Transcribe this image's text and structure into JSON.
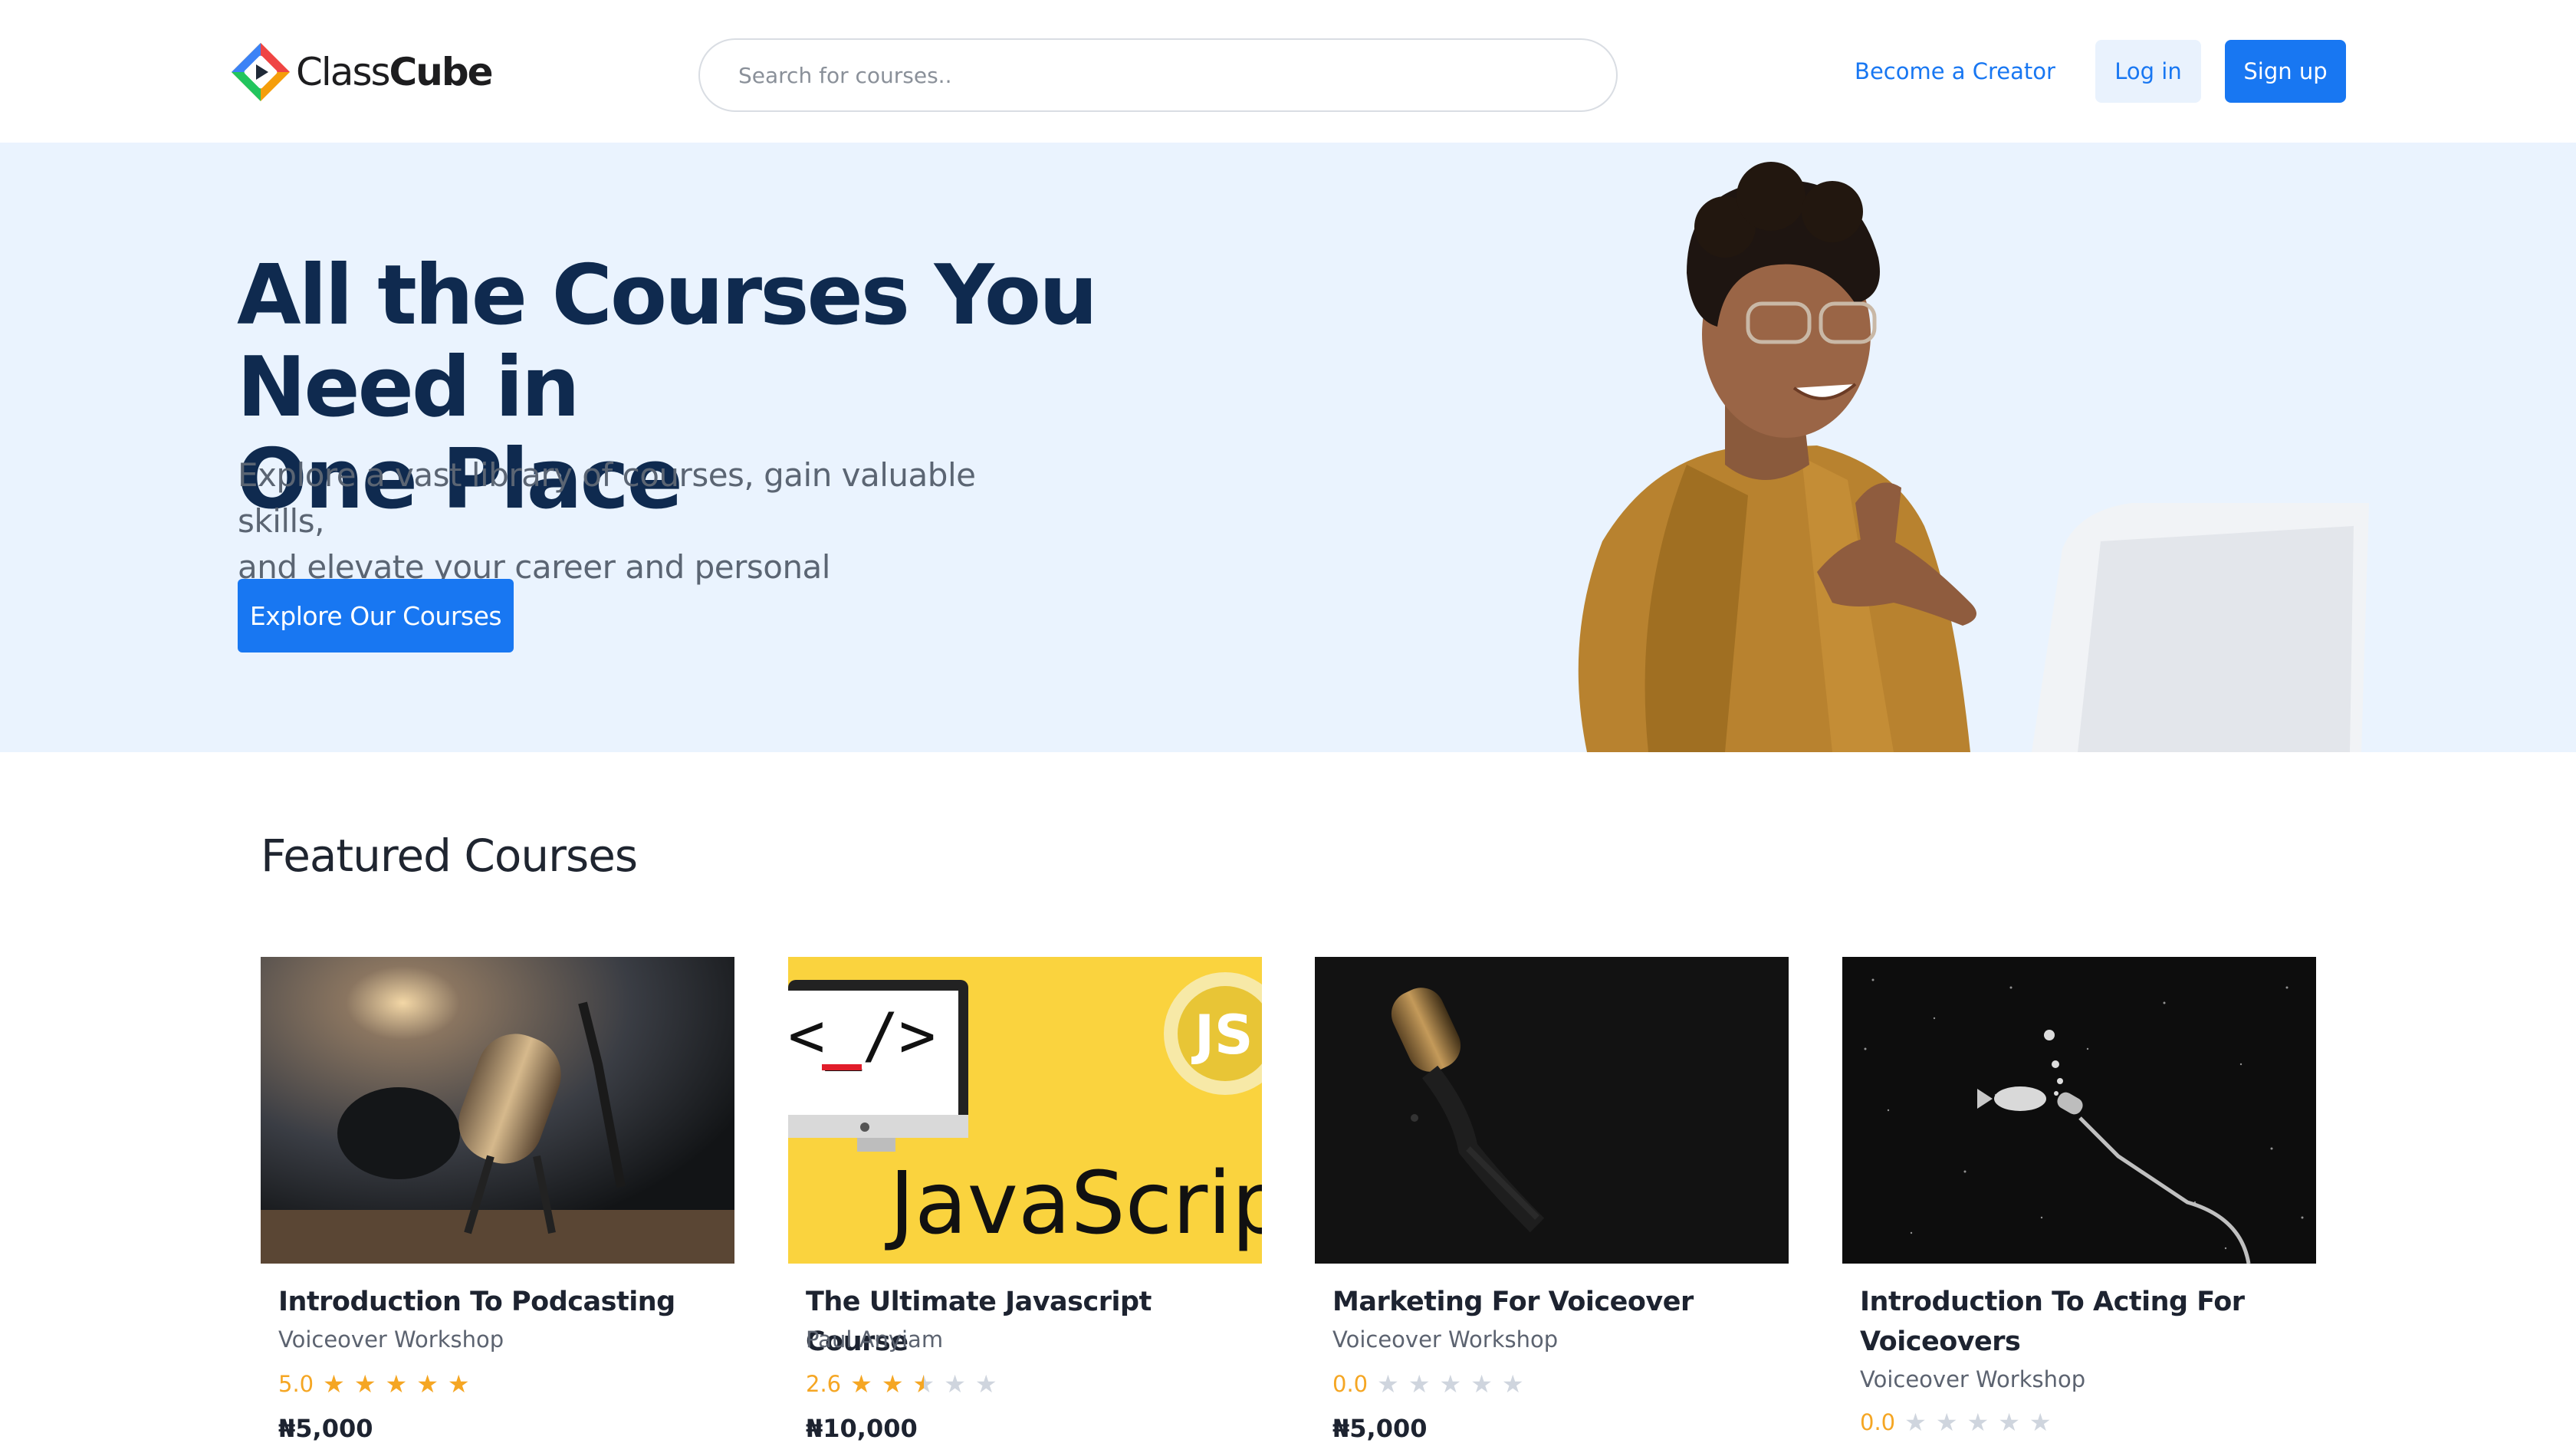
{
  "brand": {
    "name_light": "Class",
    "name_bold": "Cube"
  },
  "search": {
    "placeholder": "Search for courses.."
  },
  "nav": {
    "become_creator": "Become a Creator",
    "login": "Log in",
    "signup": "Sign up"
  },
  "hero": {
    "title_line1": "All the Courses You Need in",
    "title_line2": "One Place",
    "subtitle_line1": "Explore a vast library of courses, gain valuable skills,",
    "subtitle_line2": "and elevate your career and personal development.",
    "cta": "Explore Our Courses"
  },
  "featured": {
    "heading": "Featured Courses",
    "courses": [
      {
        "title": "Introduction To Podcasting",
        "author": "Voiceover Workshop",
        "rating": "5.0",
        "stars": 5,
        "price": "₦5,000",
        "image_icon": "podcast-microphone-image"
      },
      {
        "title": "The Ultimate Javascript Course",
        "author": "Paul Anyiam",
        "rating": "2.6",
        "stars": 2.5,
        "price": "₦10,000",
        "image_icon": "javascript-code-image"
      },
      {
        "title": "Marketing For Voiceover",
        "author": "Voiceover Workshop",
        "rating": "0.0",
        "stars": 0,
        "price": "₦5,000",
        "image_icon": "studio-microphone-image"
      },
      {
        "title": "Introduction To Acting For Voiceovers",
        "author": "Voiceover Workshop",
        "rating": "0.0",
        "stars": 0,
        "price": "",
        "image_icon": "fish-microphone-image"
      }
    ]
  },
  "colors": {
    "accent": "#1877f2",
    "hero_bg": "#eaf3fe",
    "hero_title": "#0f2a4f",
    "star": "#f5a623"
  }
}
